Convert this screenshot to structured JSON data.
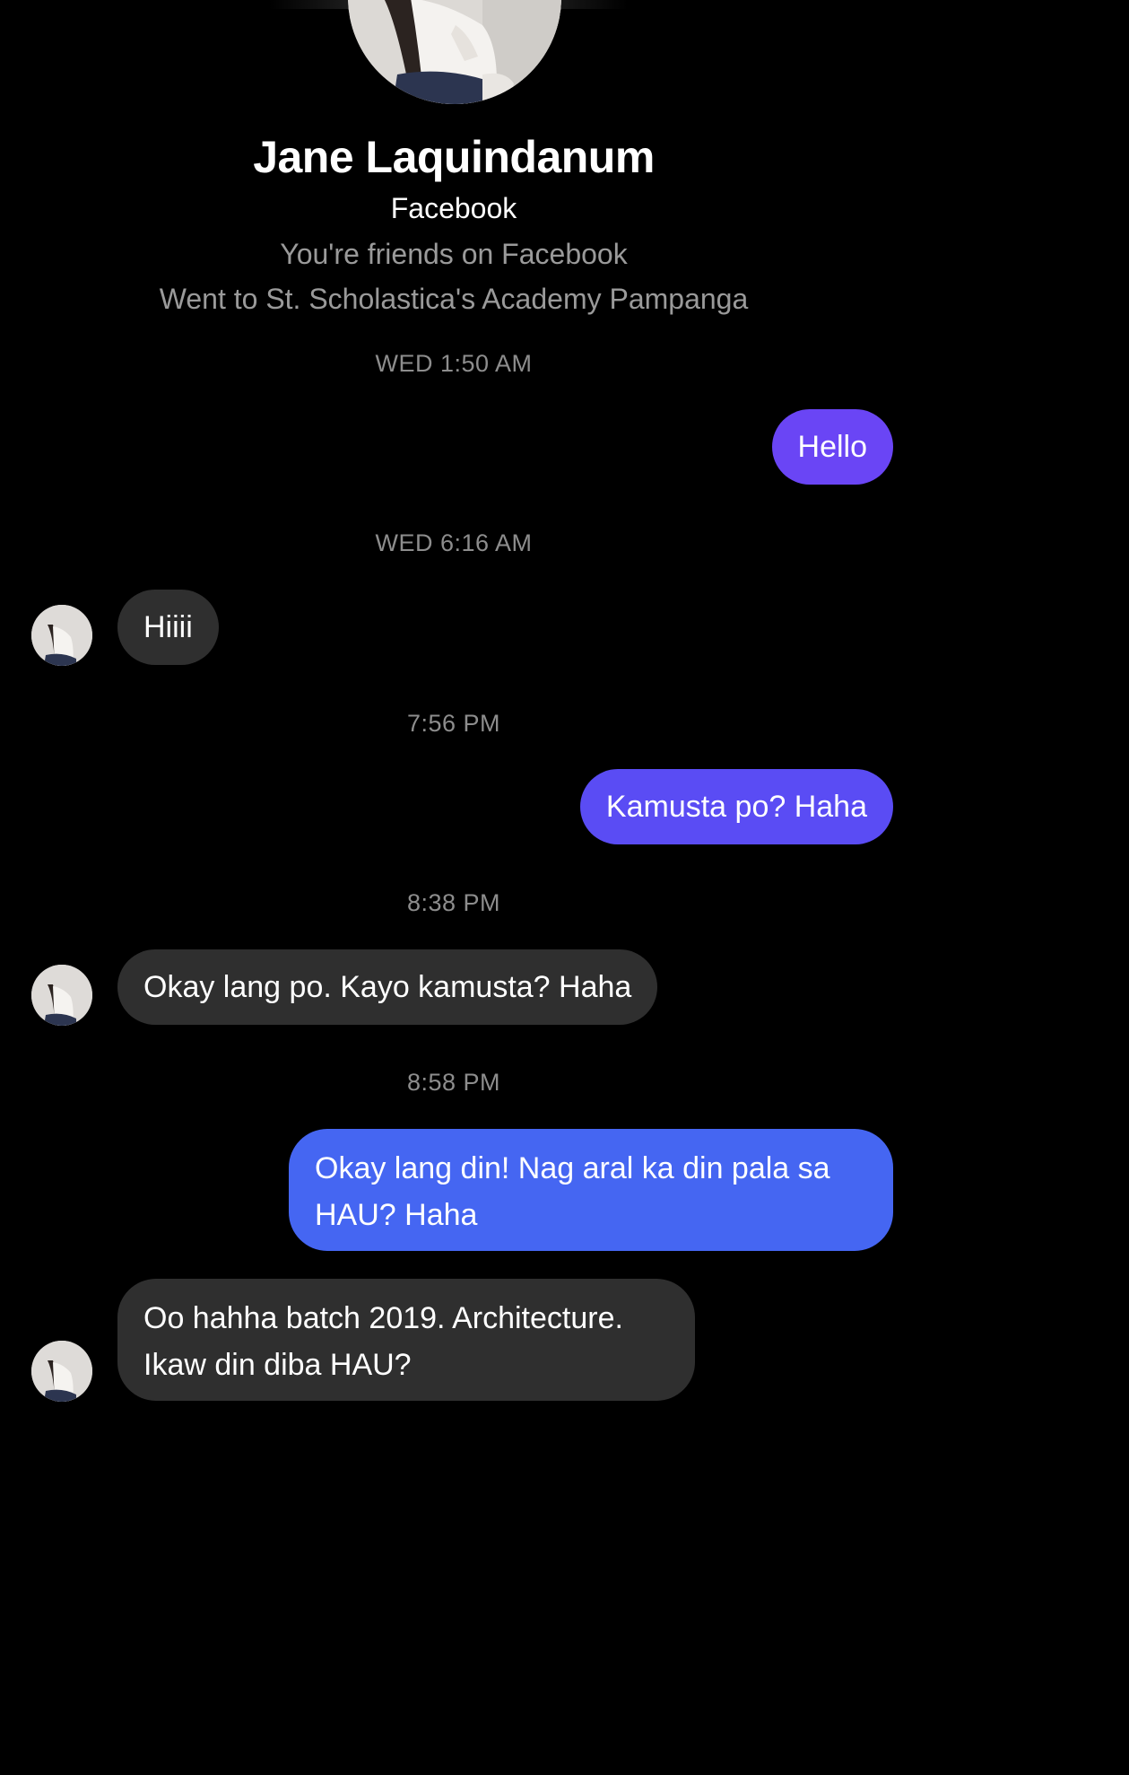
{
  "contact": {
    "name": "Jane Laquindanum",
    "source": "Facebook",
    "relationship": "You're friends on Facebook",
    "education": "Went to St. Scholastica's Academy Pampanga"
  },
  "conversation": [
    {
      "type": "timestamp",
      "text": "WED 1:50 AM"
    },
    {
      "type": "message",
      "direction": "outgoing",
      "lines": [
        "Hello"
      ],
      "color": "#6a45f5"
    },
    {
      "type": "timestamp",
      "text": "WED 6:16 AM"
    },
    {
      "type": "message",
      "direction": "incoming",
      "lines": [
        "Hiiii"
      ],
      "color": "#2f2f2f"
    },
    {
      "type": "timestamp",
      "text": "7:56 PM"
    },
    {
      "type": "message",
      "direction": "outgoing",
      "lines": [
        "Kamusta po? Haha"
      ],
      "color": "#5a4cf4"
    },
    {
      "type": "timestamp",
      "text": "8:38 PM"
    },
    {
      "type": "message",
      "direction": "incoming",
      "lines": [
        "Okay lang po. Kayo kamusta? Haha"
      ],
      "color": "#2f2f2f"
    },
    {
      "type": "timestamp",
      "text": "8:58 PM"
    },
    {
      "type": "message",
      "direction": "outgoing",
      "lines": [
        "Okay lang din! Nag aral ka din pala sa",
        "HAU? Haha"
      ],
      "color": "#4566f2"
    },
    {
      "type": "message",
      "direction": "incoming",
      "lines": [
        "Oo hahha batch 2019. Architecture.",
        "Ikaw din diba HAU?"
      ],
      "color": "#2f2f2f"
    }
  ]
}
